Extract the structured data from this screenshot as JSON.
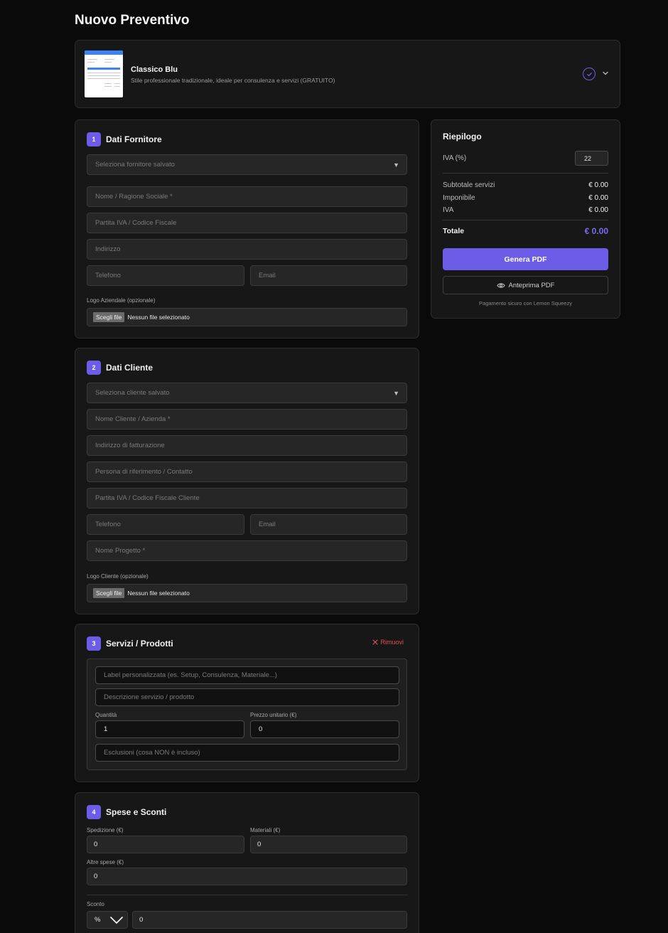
{
  "page": {
    "title": "Nuovo Preventivo"
  },
  "template": {
    "name": "Classico Blu",
    "description": "Stile professionale tradizionale, ideale per consulenza e servizi (GRATUITO)"
  },
  "supplier": {
    "number": "1",
    "title": "Dati Fornitore",
    "select_placeholder": "Seleziona fornitore salvato",
    "name_placeholder": "Nome / Ragione Sociale *",
    "vat_placeholder": "Partita IVA / Codice Fiscale",
    "address_placeholder": "Indirizzo",
    "phone_placeholder": "Telefono",
    "email_placeholder": "Email",
    "logo_label": "Logo Aziendale (opzionale)",
    "file_button": "Scegli file",
    "file_status": "Nessun file selezionato"
  },
  "client": {
    "number": "2",
    "title": "Dati Cliente",
    "select_placeholder": "Seleziona cliente salvato",
    "name_placeholder": "Nome Cliente / Azienda *",
    "billing_placeholder": "Indirizzo di fatturazione",
    "contact_placeholder": "Persona di riferimento / Contatto",
    "vat_placeholder": "Partita IVA / Codice Fiscale Cliente",
    "phone_placeholder": "Telefono",
    "email_placeholder": "Email",
    "project_placeholder": "Nome Progetto *",
    "logo_label": "Logo Cliente (opzionale)",
    "file_button": "Scegli file",
    "file_status": "Nessun file selezionato"
  },
  "services": {
    "number": "3",
    "title": "Servizi / Prodotti",
    "remove_label": "Rimuovi",
    "label_placeholder": "Label personalizzata (es. Setup, Consulenza, Materiale...)",
    "description_placeholder": "Descrizione servizio / prodotto",
    "quantity_label": "Quantità",
    "quantity_value": "1",
    "unit_price_label": "Prezzo unitario (€)",
    "unit_price_value": "0",
    "exclusions_placeholder": "Esclusioni (cosa NON è incluso)"
  },
  "expenses": {
    "number": "4",
    "title": "Spese e Sconti",
    "shipping_label": "Spedizione (€)",
    "shipping_value": "0",
    "materials_label": "Materiali (€)",
    "materials_value": "0",
    "other_label": "Altre spese (€)",
    "other_value": "0",
    "discount_label": "Sconto",
    "discount_type": "%",
    "discount_value": "0"
  },
  "summary": {
    "title": "Riepilogo",
    "vat_label": "IVA (%)",
    "vat_value": "22",
    "subtotal_label": "Subtotale servizi",
    "subtotal_value": "€ 0.00",
    "taxable_label": "Imponibile",
    "taxable_value": "€ 0.00",
    "vat_amount_label": "IVA",
    "vat_amount_value": "€ 0.00",
    "total_label": "Totale",
    "total_value": "€ 0.00",
    "generate_button": "Genera PDF",
    "preview_button": "Anteprima PDF",
    "secure_note": "Pagamento sicuro con Lemon Squeezy"
  },
  "colors": {
    "accent": "#6d5ce7",
    "danger": "#e05252",
    "background": "#0a0a0a",
    "card": "#171717"
  }
}
